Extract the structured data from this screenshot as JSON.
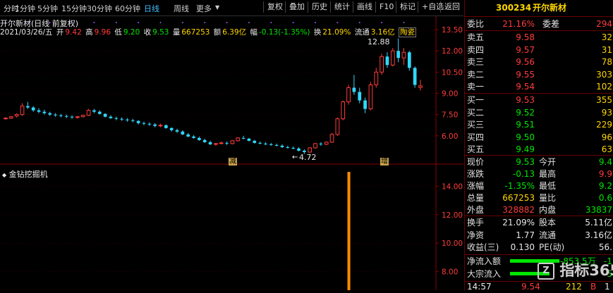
{
  "toolbar": {
    "periods": [
      "分时",
      "1分钟",
      "5分钟",
      "15分钟",
      "30分钟",
      "60分钟",
      "日线",
      "周线",
      "更多"
    ],
    "active_period": "日线",
    "buttons": [
      "复权",
      "叠加",
      "历史",
      "统计",
      "画线",
      "F10",
      "标记",
      "+自选",
      "返回"
    ]
  },
  "chart": {
    "title": "开尔新材(日线 前复权)",
    "info": {
      "date": "2021/03/26/五",
      "open_label": "开",
      "open": "9.42",
      "high_label": "高",
      "high": "9.96",
      "low_label": "低",
      "low": "9.20",
      "close_label": "收",
      "close": "9.53",
      "vol_label": "量",
      "vol": "667253",
      "amt_label": "额",
      "amt": "6.39亿",
      "chg_label": "幅",
      "chg": "-0.13(-1.35%)",
      "turn_label": "换",
      "turn": "21.09%",
      "float_label": "流通",
      "float": "3.16亿",
      "tag": "陶瓷"
    },
    "annotations": {
      "high_mark": "12.88",
      "low_mark": "4.72",
      "jian": "减",
      "zeng": "增"
    },
    "y_ticks": [
      "13.50",
      "12.00",
      "10.50",
      "9.00",
      "7.50",
      "6.00"
    ],
    "indicator": {
      "name": "金钻挖掘机",
      "y_ticks": [
        "14.00",
        "12.00",
        "10.00",
        "8.00"
      ]
    }
  },
  "chart_data": {
    "type": "candlestick",
    "title": "开尔新材(日线 前复权)",
    "ylim": [
      4.3,
      14.2
    ],
    "up_color": "#ff3c3c",
    "down_color": "#30d8ff",
    "candles": [
      [
        7.2,
        7.3,
        7.15,
        7.25
      ],
      [
        7.25,
        7.4,
        7.2,
        7.35
      ],
      [
        7.4,
        7.6,
        7.3,
        7.5
      ],
      [
        7.5,
        8.3,
        7.4,
        8.1
      ],
      [
        8.1,
        8.4,
        7.9,
        8.0
      ],
      [
        8.0,
        8.1,
        7.7,
        7.8
      ],
      [
        7.8,
        7.95,
        7.6,
        7.7
      ],
      [
        7.7,
        7.85,
        7.5,
        7.6
      ],
      [
        7.6,
        7.7,
        7.4,
        7.5
      ],
      [
        7.5,
        7.6,
        7.35,
        7.45
      ],
      [
        7.45,
        7.55,
        7.3,
        7.4
      ],
      [
        7.4,
        7.5,
        7.25,
        7.35
      ],
      [
        7.35,
        7.45,
        7.2,
        7.3
      ],
      [
        7.3,
        7.4,
        7.2,
        7.35
      ],
      [
        7.35,
        7.5,
        7.3,
        7.45
      ],
      [
        7.45,
        7.9,
        7.4,
        7.8
      ],
      [
        7.8,
        7.9,
        7.6,
        7.7
      ],
      [
        7.7,
        7.8,
        7.5,
        7.55
      ],
      [
        7.55,
        7.6,
        7.3,
        7.35
      ],
      [
        7.35,
        7.45,
        7.2,
        7.25
      ],
      [
        7.25,
        7.35,
        7.1,
        7.2
      ],
      [
        7.2,
        7.3,
        7.05,
        7.15
      ],
      [
        7.15,
        7.25,
        7.0,
        7.1
      ],
      [
        7.1,
        7.2,
        6.95,
        7.05
      ],
      [
        7.05,
        7.1,
        6.8,
        6.9
      ],
      [
        6.9,
        7.0,
        6.75,
        6.85
      ],
      [
        6.85,
        6.95,
        6.7,
        6.8
      ],
      [
        6.8,
        6.9,
        6.6,
        6.7
      ],
      [
        6.7,
        6.85,
        6.6,
        6.75
      ],
      [
        6.75,
        6.8,
        6.5,
        6.55
      ],
      [
        6.55,
        6.6,
        6.3,
        6.4
      ],
      [
        6.4,
        6.5,
        6.2,
        6.3
      ],
      [
        6.3,
        6.4,
        6.05,
        6.1
      ],
      [
        6.1,
        6.2,
        5.9,
        5.95
      ],
      [
        5.95,
        6.05,
        5.8,
        5.85
      ],
      [
        5.85,
        5.95,
        5.65,
        5.7
      ],
      [
        5.7,
        5.8,
        5.5,
        5.55
      ],
      [
        5.55,
        5.65,
        5.35,
        5.4
      ],
      [
        5.4,
        5.5,
        5.3,
        5.45
      ],
      [
        5.45,
        5.6,
        5.4,
        5.5
      ],
      [
        5.5,
        5.6,
        5.35,
        5.45
      ],
      [
        5.45,
        5.7,
        5.4,
        5.65
      ],
      [
        5.65,
        5.9,
        5.6,
        5.85
      ],
      [
        5.85,
        6.0,
        5.75,
        5.8
      ],
      [
        5.8,
        5.85,
        5.6,
        5.65
      ],
      [
        5.65,
        5.7,
        5.45,
        5.5
      ],
      [
        5.5,
        5.6,
        5.4,
        5.45
      ],
      [
        5.45,
        5.55,
        5.35,
        5.4
      ],
      [
        5.4,
        5.5,
        5.3,
        5.35
      ],
      [
        5.35,
        5.45,
        5.25,
        5.3
      ],
      [
        5.3,
        5.4,
        5.15,
        5.2
      ],
      [
        5.2,
        5.3,
        5.1,
        5.15
      ],
      [
        5.15,
        5.25,
        5.05,
        5.1
      ],
      [
        5.1,
        5.2,
        4.9,
        4.95
      ],
      [
        4.95,
        5.05,
        4.72,
        4.85
      ],
      [
        4.85,
        5.2,
        4.8,
        5.15
      ],
      [
        5.15,
        5.5,
        5.1,
        5.45
      ],
      [
        5.45,
        5.55,
        5.3,
        5.4
      ],
      [
        5.4,
        5.6,
        5.35,
        5.55
      ],
      [
        5.55,
        6.2,
        5.5,
        6.1
      ],
      [
        6.1,
        7.3,
        6.0,
        7.2
      ],
      [
        7.2,
        8.5,
        7.1,
        8.4
      ],
      [
        8.4,
        9.6,
        8.2,
        9.4
      ],
      [
        9.4,
        10.3,
        8.9,
        9.1
      ],
      [
        9.1,
        9.4,
        8.3,
        8.5
      ],
      [
        8.5,
        8.7,
        7.6,
        7.9
      ],
      [
        7.9,
        9.8,
        7.8,
        9.6
      ],
      [
        9.6,
        10.8,
        9.4,
        10.5
      ],
      [
        10.5,
        11.8,
        10.3,
        11.6
      ],
      [
        11.6,
        11.9,
        10.8,
        11.0
      ],
      [
        11.0,
        12.2,
        10.9,
        12.0
      ],
      [
        12.0,
        12.88,
        11.2,
        11.5
      ],
      [
        11.5,
        12.2,
        11.0,
        11.9
      ],
      [
        11.9,
        12.0,
        10.6,
        10.8
      ],
      [
        10.8,
        10.9,
        9.4,
        9.6
      ],
      [
        9.42,
        9.96,
        9.2,
        9.53
      ]
    ],
    "indicator_name": "金钻挖掘机",
    "indicator_ylim": [
      6.8,
      15.2
    ],
    "indicator_bar": {
      "index": 59,
      "value": 15.0
    }
  },
  "quote": {
    "code": "300234",
    "name": "开尔新材",
    "weibi_label": "委比",
    "weibi": "21.16%",
    "weicha_label": "委差",
    "weicha": "294",
    "asks": [
      {
        "label": "卖五",
        "price": "9.58",
        "qty": "32"
      },
      {
        "label": "卖四",
        "price": "9.57",
        "qty": "31"
      },
      {
        "label": "卖三",
        "price": "9.56",
        "qty": "78"
      },
      {
        "label": "卖二",
        "price": "9.55",
        "qty": "303"
      },
      {
        "label": "卖一",
        "price": "9.54",
        "qty": "102"
      }
    ],
    "bids": [
      {
        "label": "买一",
        "price": "9.53",
        "qty": "355"
      },
      {
        "label": "买二",
        "price": "9.52",
        "qty": "93"
      },
      {
        "label": "买三",
        "price": "9.51",
        "qty": "229"
      },
      {
        "label": "买四",
        "price": "9.50",
        "qty": "96"
      },
      {
        "label": "买五",
        "price": "9.49",
        "qty": "63"
      }
    ],
    "stats1": [
      {
        "l": "现价",
        "v": "9.53",
        "vc": "green",
        "l2": "今开",
        "v2": "9.4",
        "v2c": "green"
      },
      {
        "l": "涨跌",
        "v": "-0.13",
        "vc": "green",
        "l2": "最高",
        "v2": "9.9",
        "v2c": "red"
      },
      {
        "l": "涨幅",
        "v": "-1.35%",
        "vc": "green",
        "l2": "最低",
        "v2": "9.2",
        "v2c": "green"
      },
      {
        "l": "总量",
        "v": "667253",
        "vc": "yellow",
        "l2": "量比",
        "v2": "0.6",
        "v2c": "green"
      },
      {
        "l": "外盘",
        "v": "328882",
        "vc": "red",
        "l2": "内盘",
        "v2": "33837",
        "v2c": "green"
      }
    ],
    "stats2": [
      {
        "l": "换手",
        "v": "21.09%",
        "vc": "white",
        "l2": "股本",
        "v2": "5.11亿",
        "v2c": "white"
      },
      {
        "l": "净资",
        "v": "1.77",
        "vc": "white",
        "l2": "流通",
        "v2": "3.16亿",
        "v2c": "white"
      },
      {
        "l": "收益(三)",
        "v": "0.130",
        "vc": "white",
        "l2": "PE(动)",
        "v2": "56.",
        "v2c": "white"
      }
    ],
    "flow": [
      {
        "l": "净流入额",
        "v": "-853.5万",
        "v2": "-1"
      },
      {
        "l": "大宗流入",
        "v": "",
        "v2": "-5"
      }
    ],
    "tick": {
      "time": "14:57",
      "price": "9.54",
      "qty": "212",
      "dir": "B",
      "n": "1"
    }
  },
  "watermark": "指标365"
}
